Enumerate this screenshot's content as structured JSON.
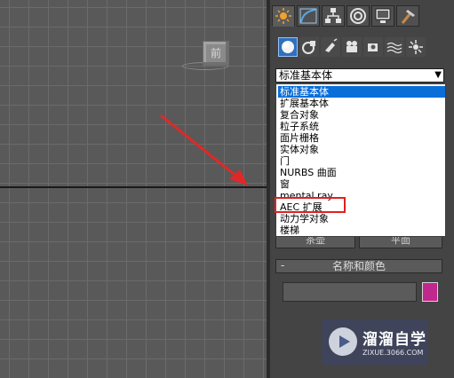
{
  "viewport": {
    "viewcube_label": "前"
  },
  "command_panel": {
    "tabs": [
      {
        "icon": "create-sun-icon",
        "active": true
      },
      {
        "icon": "modify-curve-icon"
      },
      {
        "icon": "hierarchy-icon"
      },
      {
        "icon": "motion-target-icon"
      },
      {
        "icon": "display-monitor-icon"
      },
      {
        "icon": "utilities-hammer-icon"
      }
    ],
    "subcategories": [
      {
        "icon": "geometry-sphere-icon",
        "active": true
      },
      {
        "icon": "shapes-icon"
      },
      {
        "icon": "lights-icon"
      },
      {
        "icon": "cameras-icon"
      },
      {
        "icon": "helpers-icon"
      },
      {
        "icon": "spacewarps-icon"
      },
      {
        "icon": "systems-icon"
      }
    ],
    "category_dropdown": {
      "selected": "标准基本体",
      "options": [
        "标准基本体",
        "扩展基本体",
        "复合对象",
        "粒子系统",
        "面片栅格",
        "实体对象",
        "门",
        "NURBS 曲面",
        "窗",
        "mental ray",
        "AEC 扩展",
        "动力学对象",
        "楼梯"
      ],
      "highlighted_index": 0,
      "annotated_option": "AEC 扩展"
    },
    "buttons_partial": [
      "茶壶",
      "平面"
    ],
    "name_color_rollout": {
      "title": "名称和颜色",
      "collapse_symbol": "-",
      "object_name": "",
      "color": "#c0288e"
    }
  },
  "watermark": {
    "title": "溜溜自学",
    "url": "ZIXUE.3066.COM"
  },
  "annotation": {
    "arrow_color": "#e02828",
    "highlight_color": "#e02020"
  }
}
